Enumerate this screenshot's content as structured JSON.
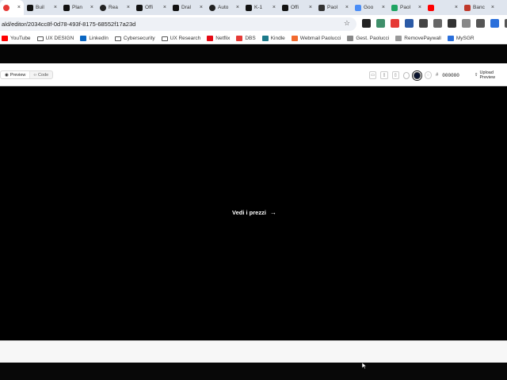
{
  "browser": {
    "tabs": [
      {
        "title": "",
        "active": true,
        "icon": "recording-icon",
        "color": "#e53935"
      },
      {
        "title": "Buil",
        "active": false,
        "icon": "app-icon",
        "color": "#111111"
      },
      {
        "title": "Plan",
        "active": false,
        "icon": "app-icon",
        "color": "#111111"
      },
      {
        "title": "Rea",
        "active": false,
        "icon": "openai-icon",
        "color": "#222222"
      },
      {
        "title": "Offi",
        "active": false,
        "icon": "app-icon",
        "color": "#111111"
      },
      {
        "title": "Dral",
        "active": false,
        "icon": "app-icon",
        "color": "#111111"
      },
      {
        "title": "Auto",
        "active": false,
        "icon": "openai-icon",
        "color": "#222222"
      },
      {
        "title": "K-1",
        "active": false,
        "icon": "app-icon",
        "color": "#111111"
      },
      {
        "title": "Offi",
        "active": false,
        "icon": "app-icon",
        "color": "#111111"
      },
      {
        "title": "Paol",
        "active": false,
        "icon": "app-icon",
        "color": "#333333"
      },
      {
        "title": "Goo",
        "active": false,
        "icon": "gemini-icon",
        "color": "#4a8df6"
      },
      {
        "title": "Paol",
        "active": false,
        "icon": "drive-icon",
        "color": "#1fa463"
      },
      {
        "title": "",
        "active": false,
        "icon": "youtube-icon",
        "color": "#ff0000"
      },
      {
        "title": "Banc",
        "active": false,
        "icon": "bank-icon",
        "color": "#c0392b"
      }
    ],
    "url": "ald/editor/2034cc8f-0d78-493f-8175-68552f17a23d",
    "extensions": [
      {
        "icon": "ext-icon",
        "color": "#222222"
      },
      {
        "icon": "ext-icon",
        "color": "#3f8f6a"
      },
      {
        "icon": "ext-icon",
        "color": "#e53935"
      },
      {
        "icon": "ext-icon",
        "color": "#2b5aa6"
      },
      {
        "icon": "ext-icon",
        "color": "#444444"
      },
      {
        "icon": "ext-icon",
        "color": "#666666"
      },
      {
        "icon": "ext-icon",
        "color": "#333333"
      },
      {
        "icon": "puzzle-icon",
        "color": "#888888"
      },
      {
        "icon": "download-icon",
        "color": "#555555"
      },
      {
        "icon": "profile-icon",
        "color": "#2a6fdb"
      },
      {
        "icon": "menu-icon",
        "color": "#555555"
      }
    ],
    "bookmarks": [
      {
        "label": "YouTube",
        "icon": "youtube-icon",
        "color": "#ff0000"
      },
      {
        "label": "UX DESIGN",
        "icon": "folder-icon",
        "color": ""
      },
      {
        "label": "LinkedIn",
        "icon": "linkedin-icon",
        "color": "#0a66c2"
      },
      {
        "label": "Cybersecurity",
        "icon": "folder-icon",
        "color": ""
      },
      {
        "label": "UX Research",
        "icon": "folder-icon",
        "color": ""
      },
      {
        "label": "Netflix",
        "icon": "netflix-icon",
        "color": "#e50914"
      },
      {
        "label": "DBS",
        "icon": "dbs-icon",
        "color": "#e53935"
      },
      {
        "label": "Kindle",
        "icon": "kindle-icon",
        "color": "#1c7a8a"
      },
      {
        "label": "Webmail Paolucci",
        "icon": "mail-icon",
        "color": "#f26a2e"
      },
      {
        "label": "Gest. Paolucci",
        "icon": "globe-icon",
        "color": "#888888"
      },
      {
        "label": "RemovePaywall",
        "icon": "diamond-icon",
        "color": "#999999"
      },
      {
        "label": "MySGR",
        "icon": "sgr-icon",
        "color": "#2a6fdb"
      }
    ]
  },
  "editor": {
    "modes": [
      {
        "label": "Preview",
        "icon": "eye-icon",
        "active": true
      },
      {
        "label": "Code",
        "icon": "code-icon",
        "active": false
      }
    ],
    "hash_symbol": "#",
    "color_hex": "000000",
    "upload_label": "Upload Preview",
    "accent_color": "#0a1430"
  },
  "preview": {
    "cta_label": "Vedi i prezzi",
    "cta_arrow": "→",
    "background": "#000000"
  }
}
